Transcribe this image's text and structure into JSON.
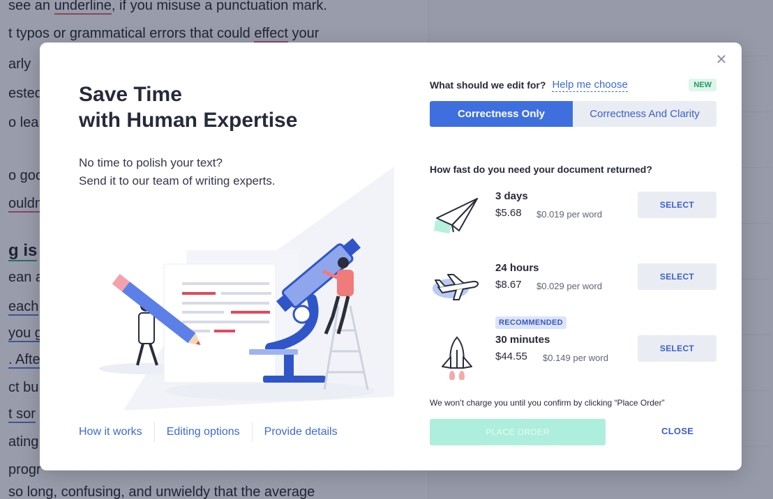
{
  "background": {
    "lines": [
      {
        "parts": [
          {
            "t": "see an ",
            "u": ""
          },
          {
            "t": "underline",
            "u": "red"
          },
          {
            "t": ", if you misuse a punctuation mark.",
            "u": ""
          },
          {
            "t": "  ",
            "u": "red"
          }
        ]
      },
      {
        "parts": [
          {
            "t": "t typos or grammatical errors that could ",
            "u": ""
          },
          {
            "t": "effect",
            "u": "red"
          },
          {
            "t": " your",
            "u": ""
          }
        ]
      },
      {
        "parts": [
          {
            "t": "arly",
            "u": ""
          }
        ]
      },
      {
        "parts": [
          {
            "t": "ested",
            "u": ""
          }
        ]
      },
      {
        "parts": [
          {
            "t": "o lea",
            "u": ""
          }
        ]
      },
      {
        "parts": [
          {
            "t": "",
            "u": ""
          }
        ]
      },
      {
        "parts": [
          {
            "t": "o goo",
            "u": ""
          }
        ]
      },
      {
        "parts": [
          {
            "t": "ouldn",
            "u": "red"
          }
        ]
      },
      {
        "parts": [
          {
            "t": "",
            "u": ""
          }
        ]
      },
      {
        "parts": [
          {
            "t": "g is",
            "u": "green"
          }
        ],
        "bold": true
      },
      {
        "parts": [
          {
            "t": "ean a",
            "u": ""
          }
        ]
      },
      {
        "parts": [
          {
            "t": "each",
            "u": "blue"
          }
        ]
      },
      {
        "parts": [
          {
            "t": "you g",
            "u": "blue"
          }
        ]
      },
      {
        "parts": [
          {
            "t": ". Afte",
            "u": "blue"
          }
        ]
      },
      {
        "parts": [
          {
            "t": "ct bu",
            "u": ""
          }
        ]
      },
      {
        "parts": [
          {
            "t": "t sor",
            "u": "blue"
          }
        ]
      },
      {
        "parts": [
          {
            "t": "ating",
            "u": ""
          }
        ]
      },
      {
        "parts": [
          {
            "t": "progr",
            "u": ""
          }
        ]
      },
      {
        "parts": [
          {
            "t": "so long, confusing, and unwieldy that the average",
            "u": ""
          }
        ]
      }
    ]
  },
  "modal": {
    "close_icon": "close-icon",
    "hero": {
      "title_line1": "Save Time",
      "title_line2": "with Human Expertise",
      "sub_line1": "No time to polish your text?",
      "sub_line2": "Send it to our team of writing experts."
    },
    "footer_links": [
      "How it works",
      "Editing options",
      "Provide details"
    ],
    "edit_for": {
      "question": "What should we edit for?",
      "help_link": "Help me choose",
      "badge": "NEW",
      "options": [
        "Correctness Only",
        "Correctness And Clarity"
      ],
      "selected": "Correctness Only"
    },
    "speed": {
      "question": "How fast do you need your document returned?",
      "options": [
        {
          "icon": "paper-plane-icon",
          "title": "3 days",
          "price": "$5.68",
          "per_word": "$0.019 per word",
          "button": "SELECT",
          "badge": ""
        },
        {
          "icon": "airplane-icon",
          "title": "24 hours",
          "price": "$8.67",
          "per_word": "$0.029 per word",
          "button": "SELECT",
          "badge": ""
        },
        {
          "icon": "rocket-icon",
          "title": "30 minutes",
          "price": "$44.55",
          "per_word": "$0.149 per word",
          "button": "SELECT",
          "badge": "RECOMMENDED"
        }
      ]
    },
    "confirm_note": "We won’t charge you until you confirm by clicking “Place Order”",
    "place_order": "PLACE ORDER",
    "close": "CLOSE"
  },
  "colors": {
    "accent": "#3f6fde",
    "link": "#3b6ad6",
    "place_order_disabled": "#aeeedc",
    "overlay": "#1c2442",
    "underline_red": "#e0637a",
    "underline_blue": "#5a7fd8",
    "underline_green": "#2fae80"
  }
}
